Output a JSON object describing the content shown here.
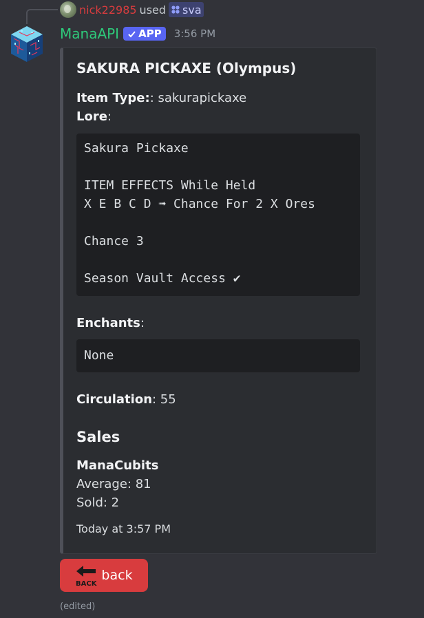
{
  "reply": {
    "username": "nick22985",
    "used_text": "used",
    "command": "sva"
  },
  "message": {
    "author": "ManaAPI",
    "badge": "APP",
    "time": "3:56 PM",
    "edited": "(edited)"
  },
  "embed": {
    "title": "SAKURA PICKAXE (Olympus)",
    "item_type_label": "Item Type:",
    "item_type_value": ": sakurapickaxe",
    "lore_label": "Lore",
    "lore_colon": ":",
    "lore_lines": [
      "Sakura Pickaxe",
      "",
      "ITEM EFFECTS While Held",
      "X E B C D ➟ Chance For 2 X Ores",
      "",
      "Chance 3",
      "",
      "Season Vault Access ✔"
    ],
    "enchants_label": "Enchants",
    "enchants_colon": ":",
    "enchants_value": "None",
    "circulation_label": "Circulation",
    "circulation_value": ": 55",
    "sales_title": "Sales",
    "currency": "ManaCubits",
    "average": "Average: 81",
    "sold": "Sold: 2",
    "footer": "Today at 3:57 PM"
  },
  "button": {
    "label": "back",
    "icon_text": "BACK"
  },
  "colors": {
    "background": "#323339",
    "embed_bg": "#2b2d31",
    "bot_name": "#2ec97a",
    "reply_user": "#d83c3e",
    "app_badge": "#5865f2",
    "button": "#d83c3e"
  }
}
